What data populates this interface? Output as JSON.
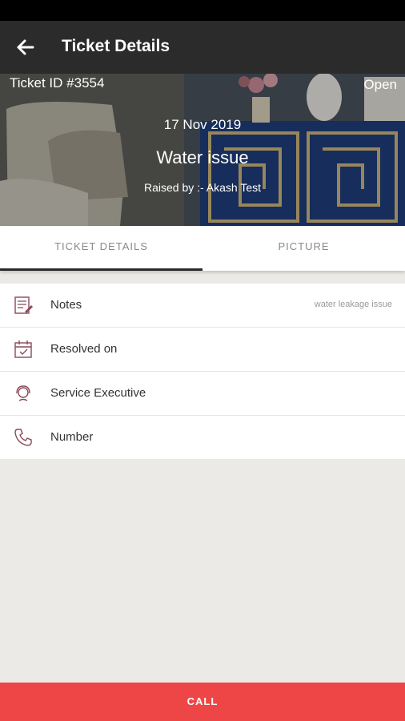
{
  "appbar": {
    "title": "Ticket Details",
    "back_icon": "arrow-left-icon"
  },
  "ticket": {
    "id_label": "Ticket ID #3554",
    "status": "Open",
    "date": "17 Nov 2019",
    "subject": "Water issue",
    "raised_by": "Raised by :- Akash Test"
  },
  "tabs": [
    {
      "label": "TICKET DETAILS",
      "selected": true
    },
    {
      "label": "PICTURE",
      "selected": false
    }
  ],
  "details": [
    {
      "label": "Notes",
      "value": "water leakage issue",
      "icon": "notes-icon"
    },
    {
      "label": "Resolved on",
      "value": "",
      "icon": "calendar-check-icon"
    },
    {
      "label": "Service Executive",
      "value": "",
      "icon": "headset-icon"
    },
    {
      "label": "Number",
      "value": "",
      "icon": "phone-icon"
    }
  ],
  "footer": {
    "call_label": "CALL"
  },
  "colors": {
    "accent": "#ee4646",
    "appbar": "#2b2b2b",
    "icon": "#8a4a5a"
  }
}
